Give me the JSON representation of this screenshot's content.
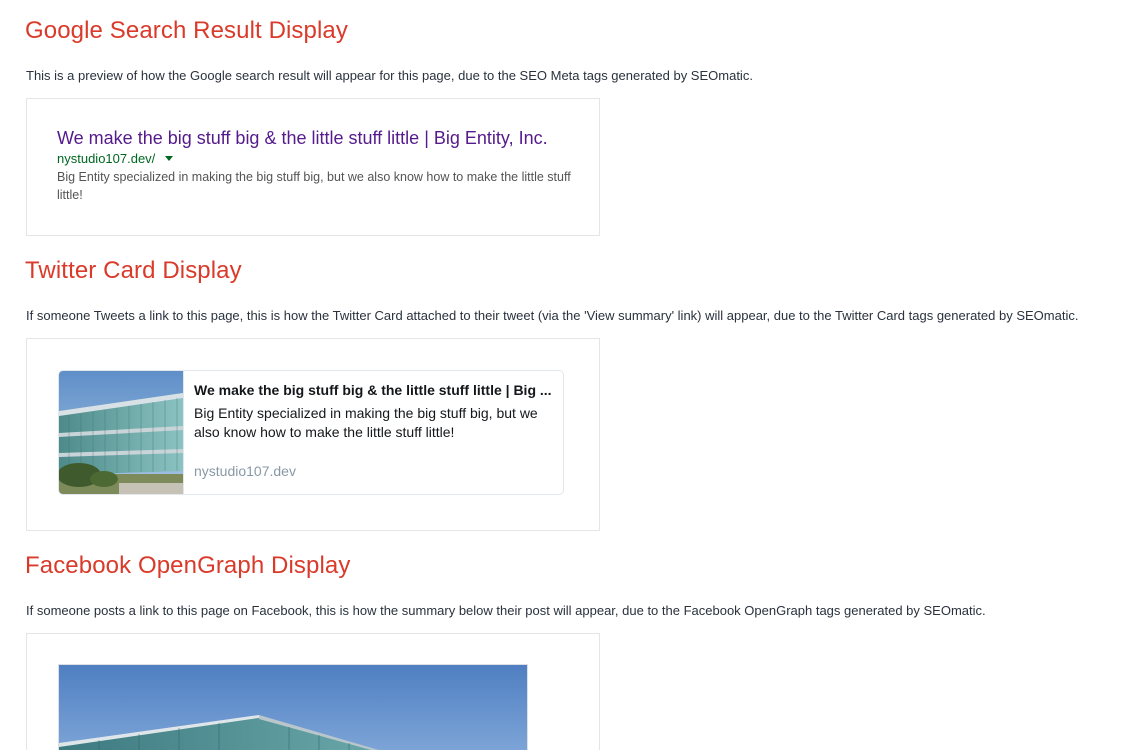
{
  "google": {
    "heading": "Google Search Result Display",
    "description": "This is a preview of how the Google search result will appear for this page, due to the SEO Meta tags generated by SEOmatic.",
    "result_title": "We make the big stuff big & the little stuff little | Big Entity, Inc.",
    "result_url": "nystudio107.dev/",
    "result_snippet": "Big Entity specialized in making the big stuff big, but we also know how to make the little stuff little!",
    "colors": {
      "title": "#551a8b",
      "url": "#006621",
      "snippet": "#545454"
    }
  },
  "twitter": {
    "heading": "Twitter Card Display",
    "description": "If someone Tweets a link to this page, this is how the Twitter Card attached to their tweet (via the 'View summary' link) will appear, due to the Twitter Card tags generated by SEOmatic.",
    "card_title": "We make the big stuff big & the little stuff little | Big ...",
    "card_description": "Big Entity specialized in making the big stuff big, but we also know how to make the little stuff little!",
    "card_domain": "nystudio107.dev"
  },
  "facebook": {
    "heading": "Facebook OpenGraph Display",
    "description": "If someone posts a link to this page on Facebook, this is how the summary below their post will appear, due to the Facebook OpenGraph tags generated by SEOmatic."
  },
  "colors": {
    "heading": "#da3a2a",
    "body_text": "#29323d",
    "box_border": "#e3e5e8"
  }
}
